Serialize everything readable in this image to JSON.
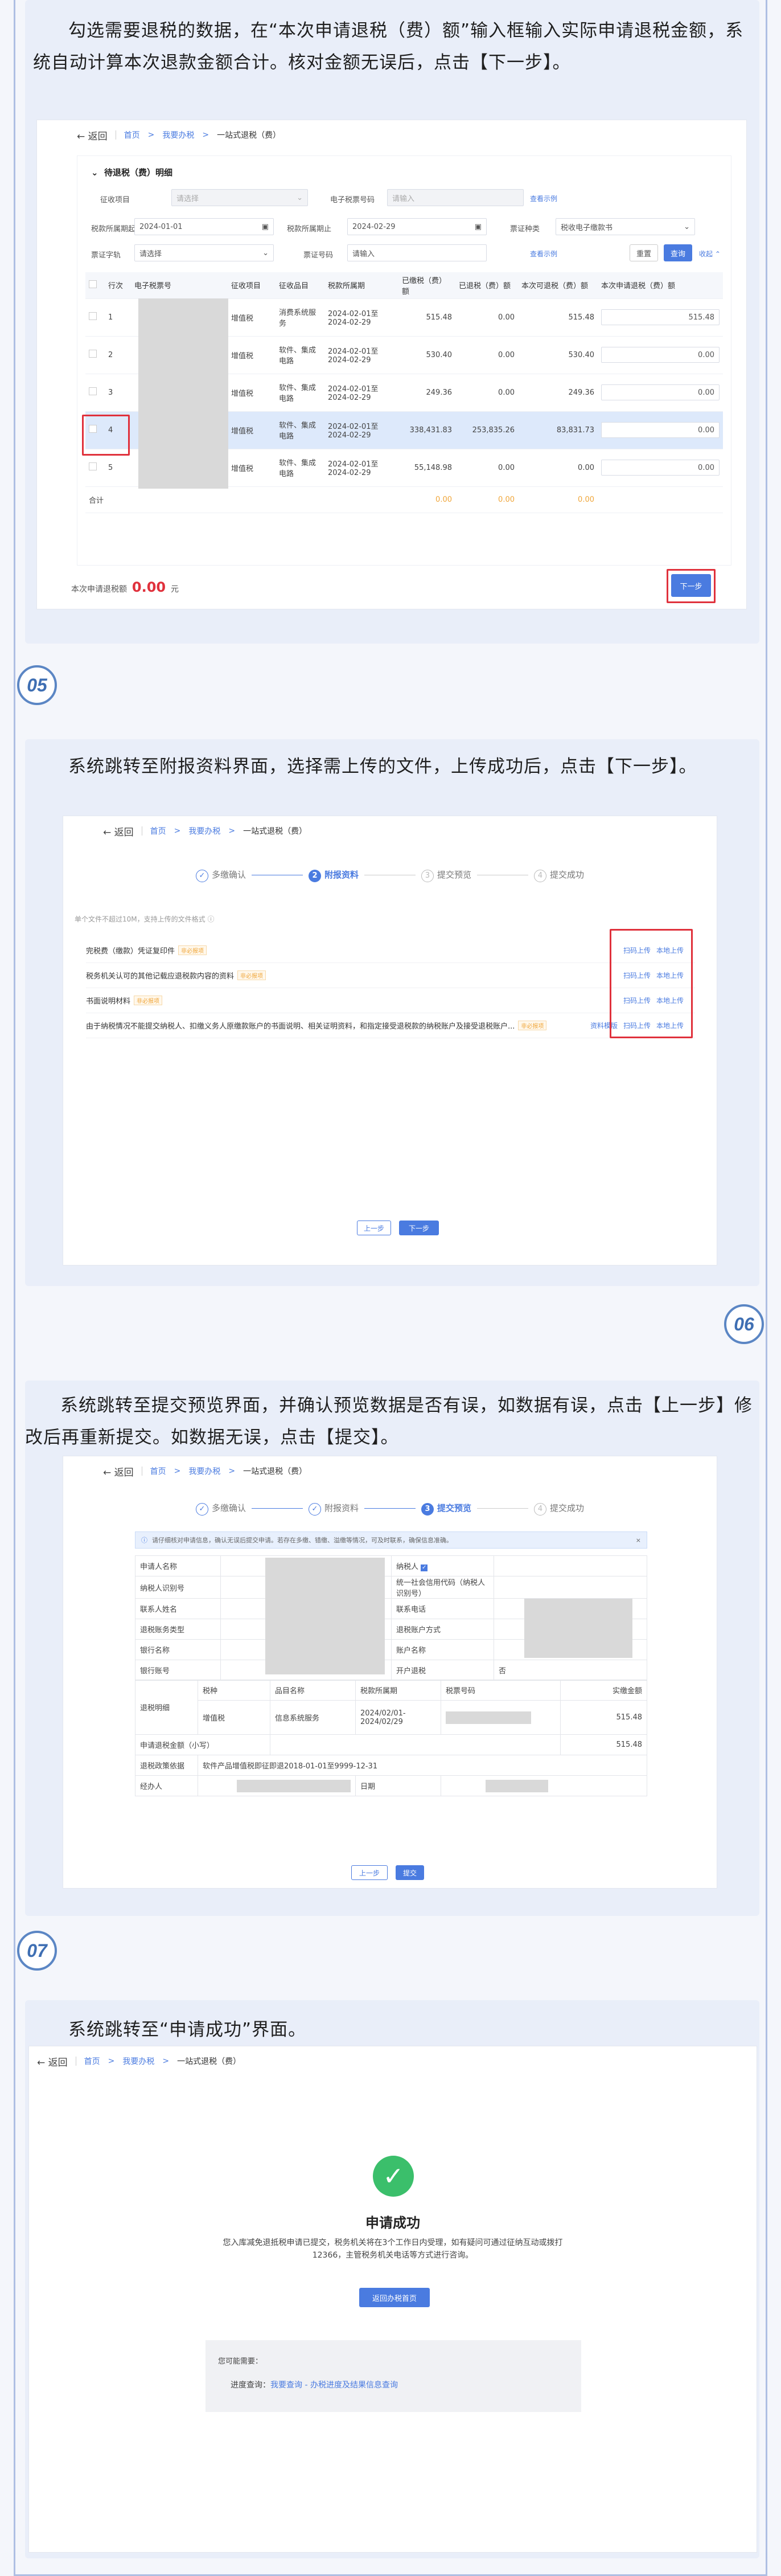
{
  "sections": {
    "s1": {
      "intro": "勾选需要退税的数据，在“本次申请退税（费）额”输入框输入实际申请退税金额，系统自动计算本次退款金额合计。核对金额无误后，点击【下一步】。"
    },
    "s2": {
      "badge": "05",
      "intro": "系统跳转至附报资料界面，选择需上传的文件，上传成功后，点击【下一步】。"
    },
    "s3": {
      "badge": "06",
      "intro": "系统跳转至提交预览界面，并确认预览数据是否有误，如数据有误，点击【上一步】修改后再重新提交。如数据无误，点击【提交】。"
    },
    "s4": {
      "badge": "07",
      "intro": "系统跳转至“申请成功”界面。"
    }
  },
  "header": {
    "back": "返回",
    "crumb_home": "首页",
    "crumb_office": "我要办税",
    "crumb_current": "一站式退税（费）"
  },
  "shot1": {
    "section_title": "待退税（费）明细",
    "filters": {
      "r1": [
        {
          "label": "征收项目",
          "value": "请选择",
          "disabled": true
        },
        {
          "label": "电子税票号码",
          "value": "请输入",
          "disabled": true
        }
      ],
      "r2": [
        {
          "label": "税款所属期起",
          "value": "2024-01-01"
        },
        {
          "label": "税款所属期止",
          "value": "2024-02-29"
        },
        {
          "label": "票证种类",
          "value": "税收电子缴款书"
        }
      ],
      "r3": [
        {
          "label": "票证字轨",
          "value": "请选择"
        },
        {
          "label": "票证号码",
          "value": "请输入"
        }
      ],
      "reset_label": "重置",
      "query_label": "查询",
      "collapse_label": "收起",
      "tip1": "查看示例",
      "tip2": "查看示例"
    },
    "columns": [
      "行次",
      "电子税票号",
      "征收项目",
      "征收品目",
      "税款所属期",
      "已缴税（费）额",
      "已退税（费）额",
      "本次可退税（费）额",
      "本次申请退税（费）额"
    ],
    "rows": [
      {
        "no": "1",
        "item": "增值税",
        "sub": "消费系统服务",
        "period": "2024-02-01至2024-02-29",
        "paid": "515.48",
        "refunded": "0.00",
        "avail": "515.48",
        "apply": "515.48"
      },
      {
        "no": "2",
        "item": "增值税",
        "sub": "软件、集成电路",
        "period": "2024-02-01至2024-02-29",
        "paid": "530.40",
        "refunded": "0.00",
        "avail": "530.40",
        "apply": "0.00"
      },
      {
        "no": "3",
        "item": "增值税",
        "sub": "软件、集成电路",
        "period": "2024-02-01至2024-02-29",
        "paid": "249.36",
        "refunded": "0.00",
        "avail": "249.36",
        "apply": "0.00"
      },
      {
        "no": "4",
        "item": "增值税",
        "sub": "软件、集成电路",
        "period": "2024-02-01至2024-02-29",
        "paid": "338,431.83",
        "refunded": "253,835.26",
        "avail": "83,831.73",
        "apply": "0.00"
      },
      {
        "no": "5",
        "item": "增值税",
        "sub": "软件、集成电路",
        "period": "2024-02-01至2024-02-29",
        "paid": "55,148.98",
        "refunded": "0.00",
        "avail": "0.00",
        "apply": "0.00"
      }
    ],
    "total_label": "合计",
    "total_vals": [
      "0.00",
      "0.00",
      "0.00"
    ],
    "sum_label": "本次申请退税额",
    "sum_value": "0.00",
    "sum_unit": "元",
    "next_label": "下一步"
  },
  "shot2": {
    "steps": [
      "多缴确认",
      "附报资料",
      "提交预览",
      "提交成功"
    ],
    "note": "单个文件不超过10M，支持上传的文件格式",
    "files": [
      {
        "name": "完税费（缴款）凭证复印件",
        "tag": "非必报项",
        "actions": [
          "扫码上传",
          "本地上传"
        ]
      },
      {
        "name": "税务机关认可的其他记载应退税款内容的资料",
        "tag": "非必报项",
        "actions": [
          "扫码上传",
          "本地上传"
        ]
      },
      {
        "name": "书面说明材料",
        "tag": "非必报项",
        "actions": [
          "扫码上传",
          "本地上传"
        ]
      },
      {
        "name": "由于纳税情况不能提交纳税人、扣缴义务人原缴款账户的书面说明、相关证明资料，和指定接受退税款的纳税账户及接受退税账户...",
        "tag": "非必报项",
        "actions": [
          "资料模版",
          "扫码上传",
          "本地上传"
        ]
      }
    ],
    "prev_label": "上一步",
    "next_label": "下一步"
  },
  "shot3": {
    "steps": [
      "多缴确认",
      "附报资料",
      "提交预览",
      "提交成功"
    ],
    "alert": "请仔细核对申请信息，确认无误后提交申请。若存在多缴、错缴、溢缴等情况，可及时联系，确保信息准确。",
    "left_labels": [
      "申请人名称",
      "纳税人识别号",
      "联系人姓名",
      "退税账务类型",
      "银行名称",
      "银行账号"
    ],
    "right_labels": [
      "纳税人",
      "统一社会信用代码（纳税人识别号）",
      "联系电话",
      "退税账户方式",
      "账户名称",
      "开户退税"
    ],
    "right_value_last": "否",
    "detail_label": "退税明细",
    "detail_cols": [
      "税种",
      "品目名称",
      "税款所属期",
      "税票号码",
      "实缴金额"
    ],
    "detail_row": {
      "tax": "增值税",
      "sub": "信息系统服务",
      "period": "2024/02/01-2024/02/29",
      "amount": "515.48"
    },
    "sum_label": "申请退税金额（小写）",
    "sum_value": "515.48",
    "basis_label": "退税政策依据",
    "basis_value": "软件产品增值税即征即退2018-01-01至9999-12-31",
    "handler_label": "经办人",
    "date_label": "日期",
    "prev_label": "上一步",
    "submit_label": "提交"
  },
  "shot4": {
    "title": "申请成功",
    "message": "您入库减免退抵税申请已提交，税务机关将在3个工作日内受理，如有疑问可通过征纳互动或拨打12366，主管税务机关电话等方式进行咨询。",
    "home_btn": "返回办税首页",
    "need_label": "您可能需要：",
    "progress_label": "进度查询：",
    "progress_link": "我要查询 - 办税进度及结果信息查询"
  }
}
